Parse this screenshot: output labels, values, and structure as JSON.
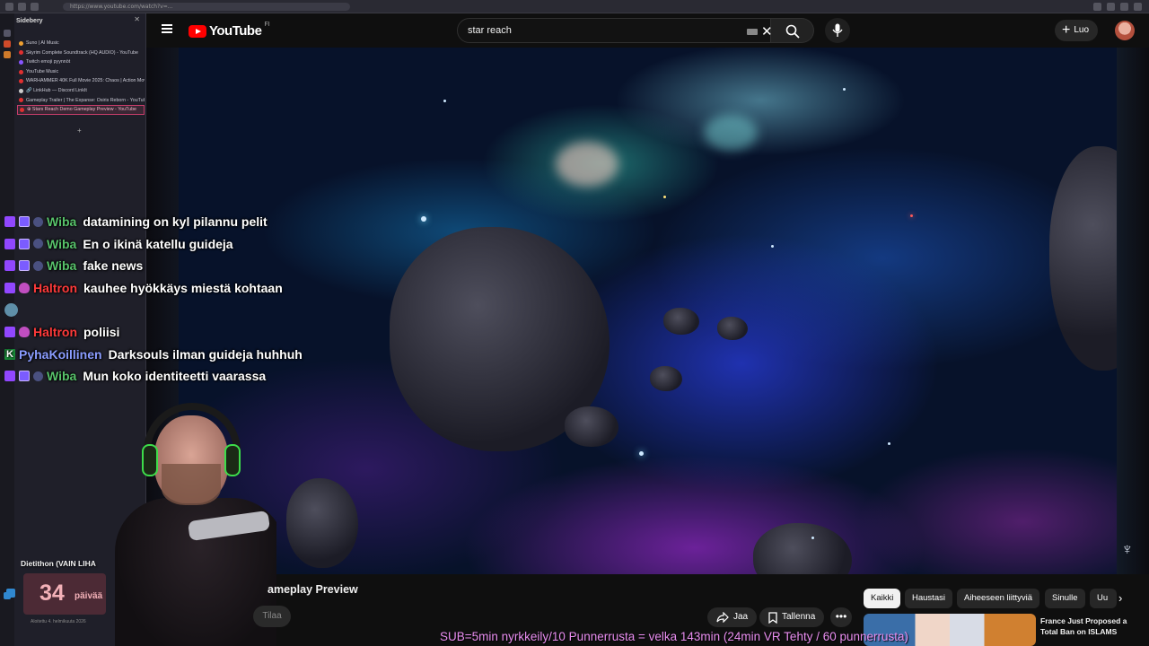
{
  "browser": {
    "url": "https://www.youtube.com/watch?v=..."
  },
  "sidebery": {
    "title": "Sidebery",
    "tabs": [
      {
        "label": "Suno | AI Music",
        "color": "#f0a030"
      },
      {
        "label": "Skyrim Complete Soundtrack (HQ AUDIO) - YouTube",
        "color": "#e03030"
      },
      {
        "label": "Twitch emoji pyynnöt",
        "color": "#8855ff"
      },
      {
        "label": "YouTube Music",
        "color": "#e03030"
      },
      {
        "label": "WARHAMMER 40K Full Movie 2025: Chaos | Action Movies",
        "color": "#e03030"
      },
      {
        "label": "🔗 LinkHub — Discord LinkIt",
        "color": "#cccccc"
      },
      {
        "label": "Gameplay Trailer | The Expanse: Osiris Reborn - YouTube",
        "color": "#e03030"
      },
      {
        "label": "⊕ Stars Reach Demo Gameplay Preview - YouTube",
        "color": "#e03030"
      }
    ]
  },
  "header": {
    "logo": "YouTube",
    "country": "FI",
    "search_query": "star reach",
    "create_label": "Luo"
  },
  "chat": [
    {
      "user": "Wiba",
      "color": "#57c26a",
      "badges": [
        "prime",
        "sub",
        "mod"
      ],
      "message": "datamining on kyl pilannu pelit"
    },
    {
      "user": "Wiba",
      "color": "#57c26a",
      "badges": [
        "prime",
        "sub",
        "mod"
      ],
      "message": "En o ikinä katellu guideja"
    },
    {
      "user": "Wiba",
      "color": "#57c26a",
      "badges": [
        "prime",
        "sub",
        "mod"
      ],
      "message": "fake news"
    },
    {
      "user": "Haltron",
      "color": "#ff3a3a",
      "badges": [
        "prime",
        "gem"
      ],
      "message": "kauhee hyökkäys miestä kohtaan"
    },
    {
      "user": "",
      "color": "#ffffff",
      "badges": [
        "emote"
      ],
      "message": ""
    },
    {
      "user": "Haltron",
      "color": "#ff3a3a",
      "badges": [
        "prime",
        "gem"
      ],
      "message": "poliisi"
    },
    {
      "user": "PyhaKoillinen",
      "color": "#8a9cff",
      "badges": [
        "k"
      ],
      "message": "Darksouls ilman guideja huhhuh"
    },
    {
      "user": "Wiba",
      "color": "#57c26a",
      "badges": [
        "prime",
        "sub",
        "mod"
      ],
      "message": "Mun koko identiteetti vaarassa"
    }
  ],
  "video": {
    "title_visible": "ameplay Preview",
    "subscribe_label": "Tilaa",
    "share_label": "Jaa",
    "save_label": "Tallenna"
  },
  "chips": [
    "Kaikki",
    "Haustasi",
    "Aiheeseen liittyviä",
    "Sinulle",
    "Uu"
  ],
  "recommendation": {
    "title": "France Just Proposed a Total Ban on ISLAMS"
  },
  "goal": {
    "label": "Dietithon (VAIN LIHA",
    "days": "34",
    "unit": "päivää",
    "started": "Aloitettu 4. helmikuuta 2026"
  },
  "ticker": "SUB=5min nyrkkeily/10 Punnerrusta = velka 143min (24min VR Tehty / 60 punnerrusta)"
}
